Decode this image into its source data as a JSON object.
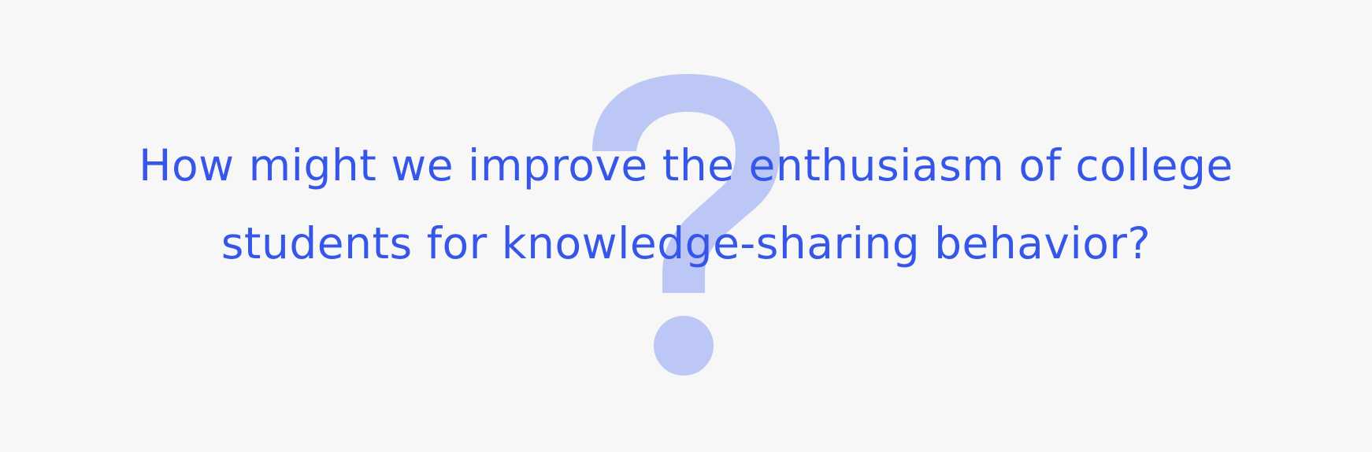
{
  "colors": {
    "background": "#F7F7F7",
    "text": "#3556E6",
    "question_mark": "#BCC7F6"
  },
  "icon": "question-mark-icon",
  "headline": {
    "line1": "How might we improve the enthusiasm of college",
    "line2": "students for knowledge-sharing behavior?"
  }
}
